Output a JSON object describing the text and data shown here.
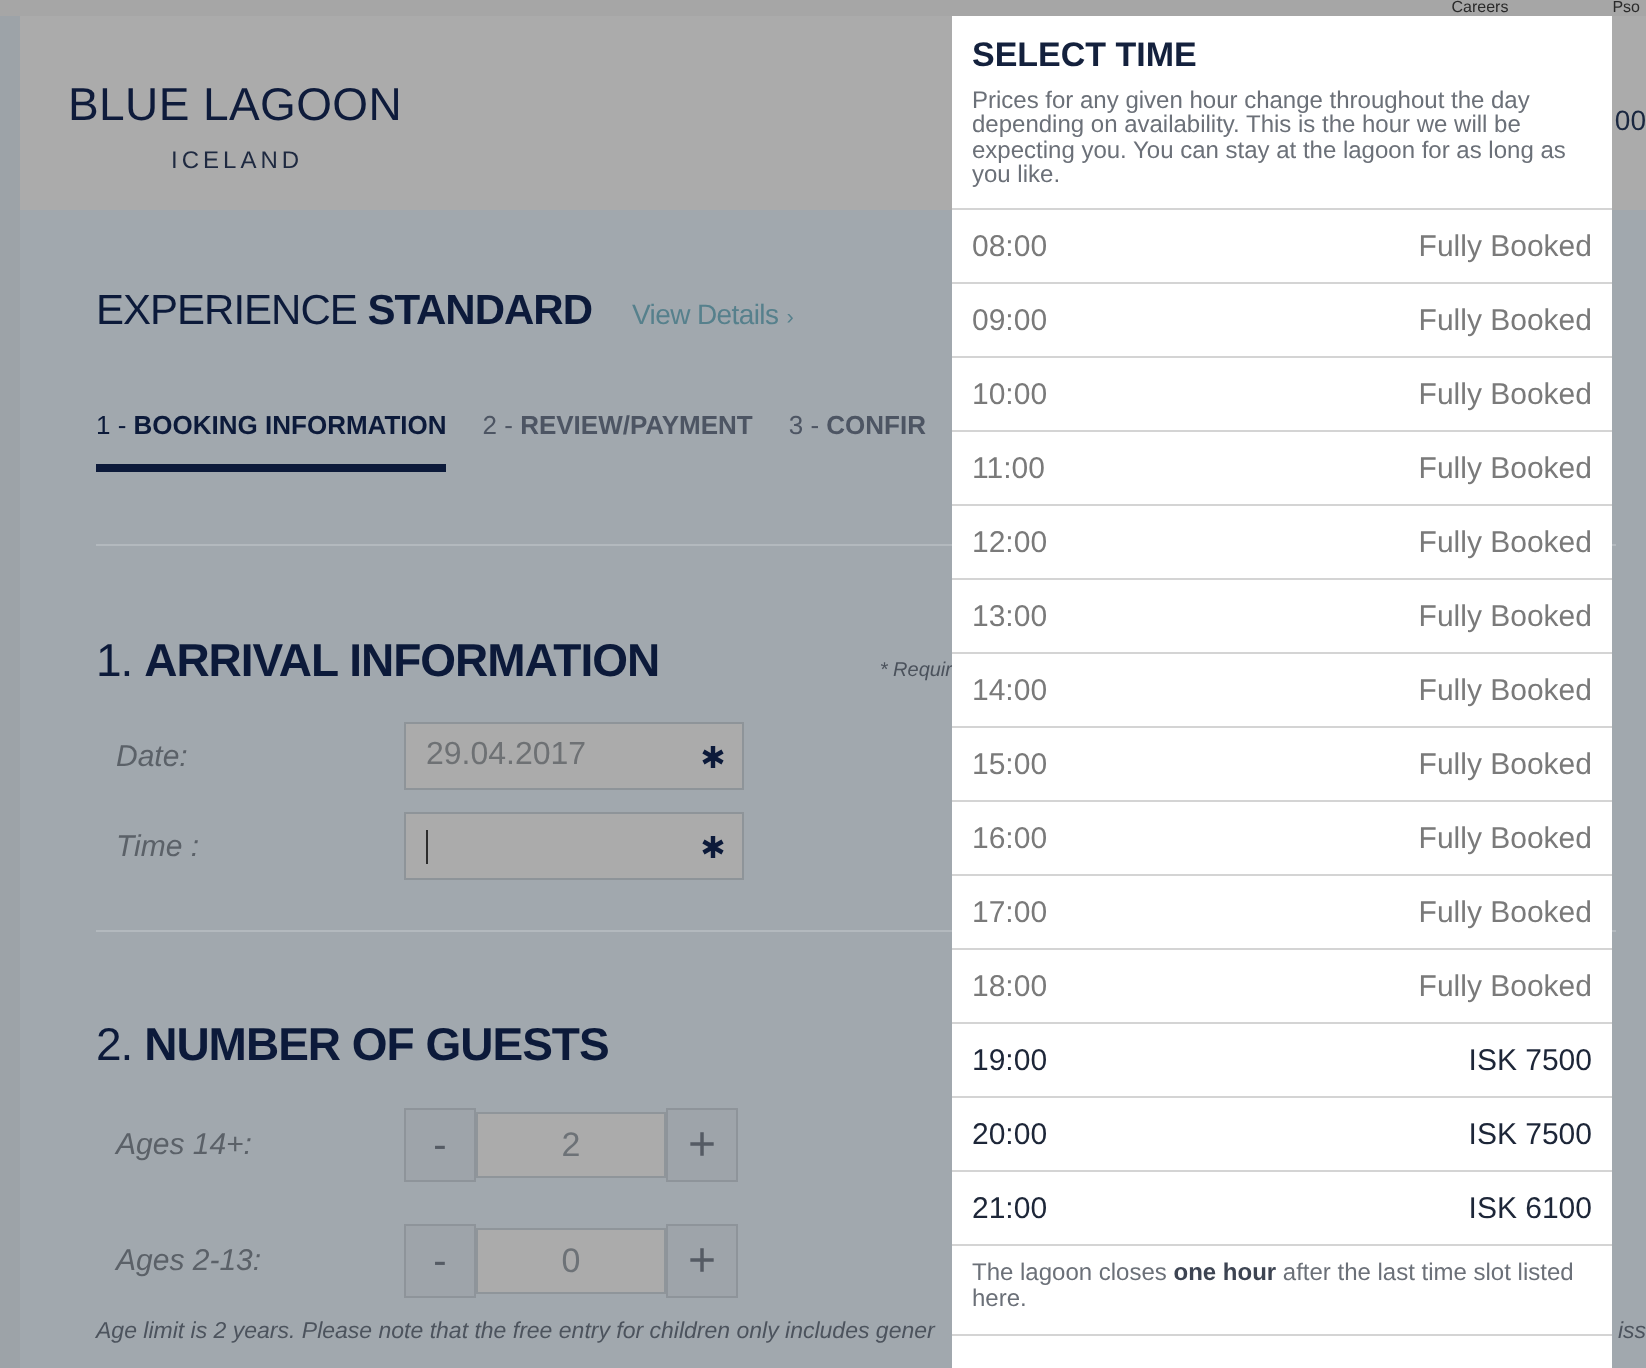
{
  "top_nav": {
    "links": [
      "Careers",
      "Pso"
    ]
  },
  "header": {
    "logo_title": "BLUE LAGOON",
    "logo_subtitle": "ICELAND",
    "right_text": "00"
  },
  "experience": {
    "title": "EXPERIENCE **STANDARD**",
    "details_link": {
      "label": "View Details",
      "arrow": "›"
    }
  },
  "steps": [
    {
      "label": "1 - **BOOKING INFORMATION**",
      "selected": true
    },
    {
      "label": "2 - **REVIEW/PAYMENT**",
      "selected": false
    },
    {
      "label": "3 - **CONFIR**",
      "selected": false
    }
  ],
  "arrival": {
    "heading": "1. **ARRIVAL INFORMATION**",
    "required_note": "* Requir",
    "fields": [
      {
        "label": "Date:",
        "value": "29.04.2017",
        "required": true,
        "focused": false
      },
      {
        "label": "Time :",
        "required": true,
        "focused": true
      }
    ]
  },
  "guests": {
    "heading": "2. **NUMBER OF GUESTS**",
    "counters": [
      {
        "label": "Ages 14+:",
        "value": "2",
        "minus": "-",
        "plus": "+"
      },
      {
        "label": "Ages 2-13:",
        "value": "0",
        "minus": "-",
        "plus": "+"
      }
    ],
    "note": "Age limit is 2 years. Please note that the free entry for children only includes gener",
    "note_fragment": "iss"
  },
  "time_picker": {
    "title": "SELECT TIME",
    "description": "Prices for any given hour change throughout the day depending on availability. This is the hour we will be expecting you. You can stay at the lagoon for as long as you like.",
    "slots": [
      {
        "time": "08:00",
        "price": "Fully Booked",
        "disabled": true
      },
      {
        "time": "09:00",
        "price": "Fully Booked",
        "disabled": true
      },
      {
        "time": "10:00",
        "price": "Fully Booked",
        "disabled": true
      },
      {
        "time": "11:00",
        "price": "Fully Booked",
        "disabled": true
      },
      {
        "time": "12:00",
        "price": "Fully Booked",
        "disabled": true
      },
      {
        "time": "13:00",
        "price": "Fully Booked",
        "disabled": true
      },
      {
        "time": "14:00",
        "price": "Fully Booked",
        "disabled": true
      },
      {
        "time": "15:00",
        "price": "Fully Booked",
        "disabled": true
      },
      {
        "time": "16:00",
        "price": "Fully Booked",
        "disabled": true
      },
      {
        "time": "17:00",
        "price": "Fully Booked",
        "disabled": true
      },
      {
        "time": "18:00",
        "price": "Fully Booked",
        "disabled": true
      },
      {
        "time": "19:00",
        "price": "ISK 7500",
        "disabled": false
      },
      {
        "time": "20:00",
        "price": "ISK 7500",
        "disabled": false
      },
      {
        "time": "21:00",
        "price": "ISK 6100",
        "disabled": false
      }
    ],
    "footer_note": "The lagoon closes **one hour** after the last time slot listed here."
  }
}
